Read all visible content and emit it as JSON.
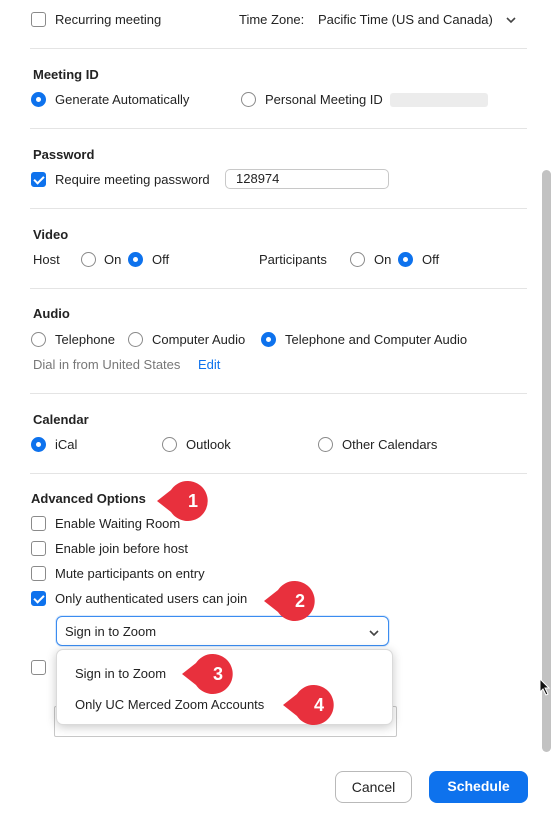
{
  "recurring": {
    "label": "Recurring meeting",
    "checked": false
  },
  "timezone": {
    "label": "Time Zone:",
    "value": "Pacific Time (US and Canada)"
  },
  "meeting_id": {
    "title": "Meeting ID",
    "generate": "Generate Automatically",
    "personal": "Personal Meeting ID"
  },
  "password": {
    "title": "Password",
    "require_label": "Require meeting password",
    "value": "128974"
  },
  "video": {
    "title": "Video",
    "host": "Host",
    "participants": "Participants",
    "on": "On",
    "off": "Off"
  },
  "audio": {
    "title": "Audio",
    "telephone": "Telephone",
    "computer": "Computer Audio",
    "both": "Telephone and Computer Audio",
    "dial_in": "Dial in from United States",
    "edit": "Edit"
  },
  "calendar": {
    "title": "Calendar",
    "ical": "iCal",
    "outlook": "Outlook",
    "other": "Other Calendars"
  },
  "advanced": {
    "title": "Advanced Options",
    "waiting_room": "Enable Waiting Room",
    "join_before_host": "Enable join before host",
    "mute_on_entry": "Mute participants on entry",
    "auth_only": "Only authenticated users can join",
    "auth_selected": "Sign in to Zoom",
    "auth_options": [
      "Sign in to Zoom",
      "Only UC Merced Zoom Accounts"
    ]
  },
  "callouts": [
    "1",
    "2",
    "3",
    "4"
  ],
  "buttons": {
    "cancel": "Cancel",
    "schedule": "Schedule"
  },
  "colors": {
    "accent": "#0e72ed",
    "callout": "#e8303d"
  }
}
